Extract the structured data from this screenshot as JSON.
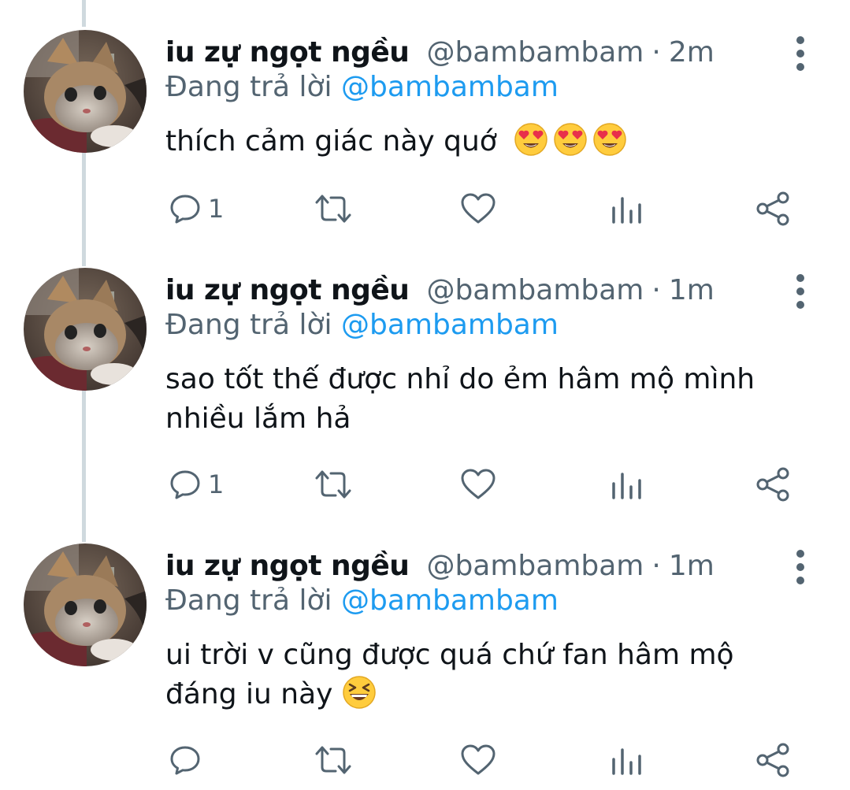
{
  "colors": {
    "accent": "#1d9bf0",
    "muted": "#536471",
    "text": "#0f1419",
    "thread_line": "#cfd9de"
  },
  "tweets": [
    {
      "display_name": "iu zự ngọt ngều",
      "handle": "@bambambam",
      "separator": "·",
      "time": "2m",
      "replying_prefix": "Đang trả lời",
      "replying_to": "@bambambam",
      "text_lines": [
        "thích cảm giác này quớ"
      ],
      "emoji": [
        "heart-eyes",
        "heart-eyes",
        "heart-eyes"
      ],
      "reply_count": "1"
    },
    {
      "display_name": "iu zự ngọt ngều",
      "handle": "@bambambam",
      "separator": "·",
      "time": "1m",
      "replying_prefix": "Đang trả lời",
      "replying_to": "@bambambam",
      "text_lines": [
        "sao tốt thế được nhỉ do ẻm hâm mộ mình",
        "nhiều lắm hả"
      ],
      "emoji": [],
      "reply_count": "1"
    },
    {
      "display_name": "iu zự ngọt ngều",
      "handle": "@bambambam",
      "separator": "·",
      "time": "1m",
      "replying_prefix": "Đang trả lời",
      "replying_to": "@bambambam",
      "text_lines": [
        "ui trời v cũng được quá chứ fan hâm mộ",
        "đáng iu này"
      ],
      "emoji": [
        "grinning-squinting"
      ],
      "reply_count": ""
    }
  ],
  "icons": {
    "reply": "reply-bubble-icon",
    "retweet": "retweet-icon",
    "like": "heart-icon",
    "views": "analytics-icon",
    "share": "share-icon",
    "more": "more-vertical-icon"
  }
}
